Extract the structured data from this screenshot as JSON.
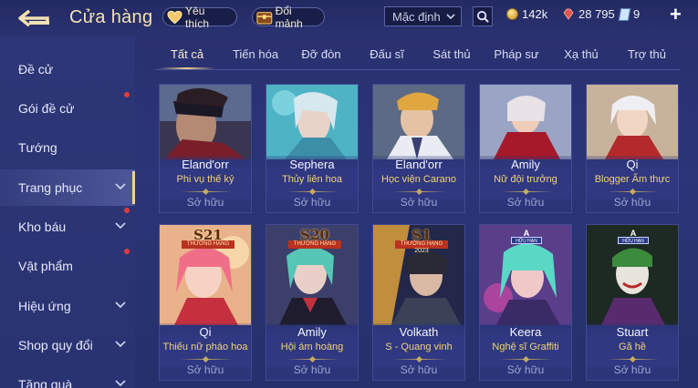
{
  "header": {
    "title": "Cửa hàng",
    "favorites_label": "Yêu thích",
    "fragments_label": "Đổi mảnh",
    "sort_value": "Mặc định",
    "currencies": {
      "gold": "142k",
      "ruby": "28 795",
      "voucher": "9"
    },
    "add_icon": "+"
  },
  "sidebar": {
    "items": [
      {
        "label": "Đề cử",
        "expand": false,
        "dot": false
      },
      {
        "label": "Gói đề cử",
        "expand": false,
        "dot": true
      },
      {
        "label": "Tướng",
        "expand": false,
        "dot": false
      },
      {
        "label": "Trang phục",
        "expand": true,
        "dot": false,
        "active": true
      },
      {
        "label": "Kho báu",
        "expand": true,
        "dot": true
      },
      {
        "label": "Vật phẩm",
        "expand": false,
        "dot": true
      },
      {
        "label": "Hiệu ứng",
        "expand": true,
        "dot": false
      },
      {
        "label": "Shop quy đổi",
        "expand": true,
        "dot": false
      },
      {
        "label": "Tặng quà",
        "expand": true,
        "dot": false
      }
    ]
  },
  "tabs": [
    "Tất cả",
    "Tiến hóa",
    "Đỡ đòn",
    "Đấu sĩ",
    "Sát thủ",
    "Pháp sư",
    "Xạ thủ",
    "Trợ thủ"
  ],
  "active_tab": "Tất cả",
  "cards_row1": [
    {
      "hero": "Eland'orr",
      "skin": "Phi vụ thế kỷ",
      "status": "Sở hữu"
    },
    {
      "hero": "Sephera",
      "skin": "Thủy liên hoa",
      "status": "Sở hữu"
    },
    {
      "hero": "Eland'orr",
      "skin": "Học viện Carano",
      "status": "Sở hữu"
    },
    {
      "hero": "Amily",
      "skin": "Nữ đội trưởng",
      "status": "Sở hữu"
    },
    {
      "hero": "Qi",
      "skin": "Blogger Ẩm thực",
      "status": "Sở hữu"
    }
  ],
  "cards_row2": [
    {
      "hero": "Qi",
      "skin": "Thiếu nữ pháo hoa",
      "status": "Sở hữu",
      "season": "S21",
      "rank": "THƯỜNG HẠNG"
    },
    {
      "hero": "Amily",
      "skin": "Hội ám hoàng",
      "status": "Sở hữu",
      "season": "S20",
      "rank": "THƯỜNG HẠNG"
    },
    {
      "hero": "Volkath",
      "skin": "S - Quang vinh",
      "status": "Sở hữu",
      "season": "S1",
      "rank": "THƯỜNG HẠNG",
      "year": "2023"
    },
    {
      "hero": "Keera",
      "skin": "Nghệ sĩ Graffiti",
      "status": "Sở hữu",
      "limited": "A",
      "limited_text": "HỮU HẠN"
    },
    {
      "hero": "Stuart",
      "skin": "Gã hề",
      "status": "Sở hữu",
      "limited": "A",
      "limited_text": "HỮU HẠN"
    }
  ],
  "colors": {
    "background": "#2a3372",
    "accent_gold": "#f0d48a",
    "skin_name": "#f3d27a",
    "notification_dot": "#e33b3b"
  }
}
